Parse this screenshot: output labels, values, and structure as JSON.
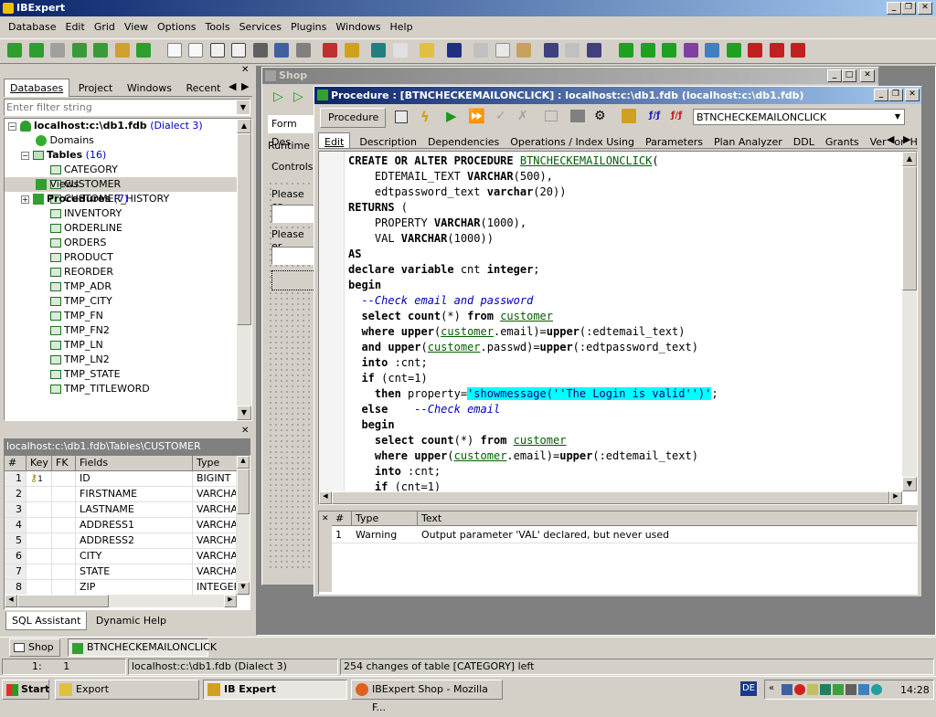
{
  "app": {
    "title": "IBExpert"
  },
  "menu": [
    "Database",
    "Edit",
    "Grid",
    "View",
    "Options",
    "Tools",
    "Services",
    "Plugins",
    "Windows",
    "Help"
  ],
  "db_panel": {
    "tabs": [
      "Databases",
      "Project",
      "Windows",
      "Recent"
    ],
    "filter_placeholder": "Enter filter string",
    "root": "localhost:c:\\db1.fdb",
    "dialect": "(Dialect 3)",
    "domains": "Domains",
    "tables_label": "Tables",
    "tables_count": "(16)",
    "tables": [
      "CATEGORY",
      "CUSTOMER",
      "CUSTOMER_HISTORY",
      "INVENTORY",
      "ORDERLINE",
      "ORDERS",
      "PRODUCT",
      "REORDER",
      "TMP_ADR",
      "TMP_CITY",
      "TMP_FN",
      "TMP_FN2",
      "TMP_LN",
      "TMP_LN2",
      "TMP_STATE",
      "TMP_TITLEWORD"
    ],
    "views": "Views",
    "procedures_label": "Procedures",
    "procedures_count": "(7)"
  },
  "fields_panel": {
    "path": "localhost:c:\\db1.fdb\\Tables\\CUSTOMER",
    "headers": [
      "#",
      "Key",
      "FK",
      "Fields",
      "Type"
    ],
    "rows": [
      [
        "1",
        "",
        "",
        "ID",
        "BIGINT"
      ],
      [
        "2",
        "",
        "",
        "FIRSTNAME",
        "VARCHAR"
      ],
      [
        "3",
        "",
        "",
        "LASTNAME",
        "VARCHAR"
      ],
      [
        "4",
        "",
        "",
        "ADDRESS1",
        "VARCHAR"
      ],
      [
        "5",
        "",
        "",
        "ADDRESS2",
        "VARCHAR"
      ],
      [
        "6",
        "",
        "",
        "CITY",
        "VARCHAR"
      ],
      [
        "7",
        "",
        "",
        "STATE",
        "VARCHAR"
      ],
      [
        "8",
        "",
        "",
        "ZIP",
        "INTEGER"
      ]
    ],
    "key_mark": "1",
    "bottom_tabs": [
      "SQL Assistant",
      "Dynamic Help"
    ]
  },
  "shop_window": {
    "title": "Shop",
    "tabs": [
      "Form Des",
      "Runtime",
      "Controls"
    ],
    "labels": [
      "Please er",
      "Please er"
    ]
  },
  "proc_window": {
    "title": "Procedure : [BTNCHECKEMAILONCLICK] : localhost:c:\\db1.fdb (localhost:c:\\db1.fdb)",
    "procedure_btn": "Procedure",
    "name_value": "BTNCHECKEMAILONCLICK",
    "tabs": [
      "Edit",
      "Description",
      "Dependencies",
      "Operations / Index Using",
      "Parameters",
      "Plan Analyzer",
      "DDL",
      "Grants",
      "Version His"
    ],
    "msg_headers": [
      "#",
      "Type",
      "Text"
    ],
    "messages": [
      [
        "1",
        "Warning",
        "Output parameter 'VAL' declared, but never used"
      ]
    ]
  },
  "code": {
    "proc_name": "BTNCHECKEMAILONCLICK",
    "tbl": "customer",
    "str1": "'showmessage(''The Login is valid'')'",
    "cm1": "--Check email and password",
    "cm2": "--Check email"
  },
  "tasks": [
    "Shop",
    "BTNCHECKEMAILONCLICK"
  ],
  "status": {
    "pos": "1:",
    "col": "1",
    "db": "localhost:c:\\db1.fdb (Dialect 3)",
    "changes": "254 changes of table [CATEGORY] left"
  },
  "taskbar": {
    "start": "Start",
    "items": [
      "Export",
      "IB Expert",
      "IBExpert Shop - Mozilla F..."
    ],
    "lang": "DE",
    "clock": "14:28"
  }
}
